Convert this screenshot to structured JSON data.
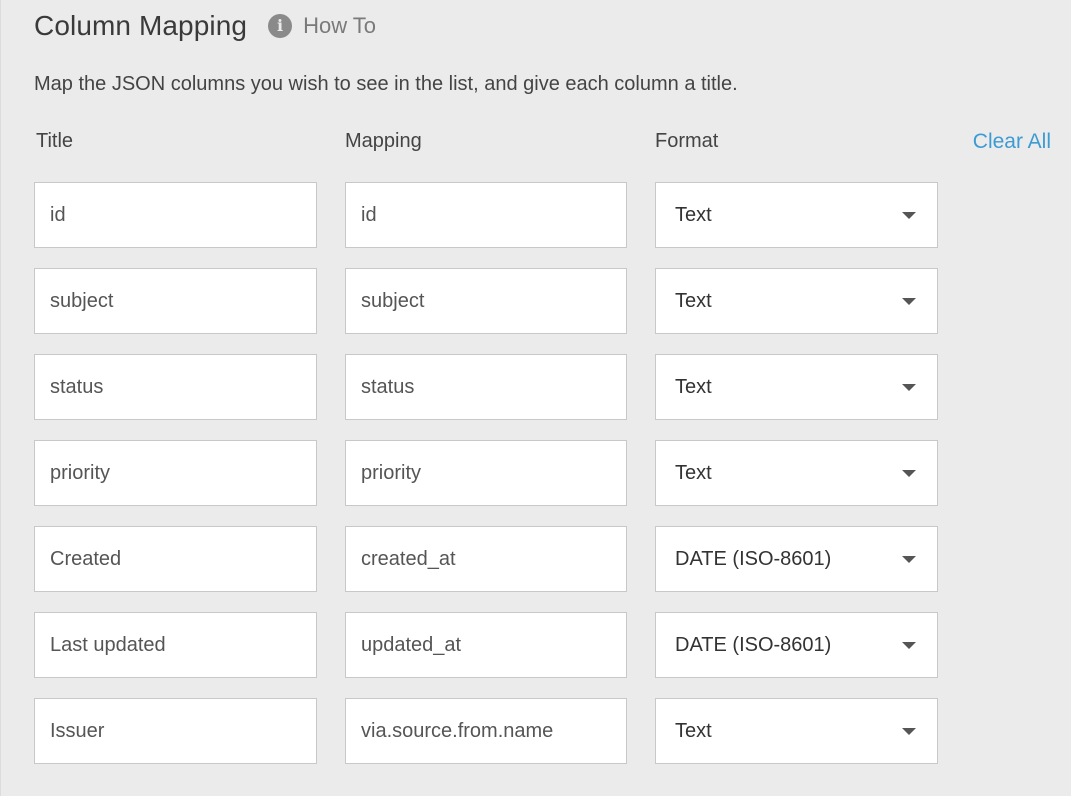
{
  "header": {
    "title": "Column Mapping",
    "info_icon": "info-circle-icon",
    "howto_label": "How To"
  },
  "description": "Map the JSON columns you wish to see in the list, and give each column a title.",
  "columns": {
    "title_label": "Title",
    "mapping_label": "Mapping",
    "format_label": "Format",
    "clear_all_label": "Clear All"
  },
  "rows": [
    {
      "title": "id",
      "mapping": "id",
      "format": "Text"
    },
    {
      "title": "subject",
      "mapping": "subject",
      "format": "Text"
    },
    {
      "title": "status",
      "mapping": "status",
      "format": "Text"
    },
    {
      "title": "priority",
      "mapping": "priority",
      "format": "Text"
    },
    {
      "title": "Created",
      "mapping": "created_at",
      "format": "DATE (ISO-8601)"
    },
    {
      "title": "Last updated",
      "mapping": "updated_at",
      "format": "DATE (ISO-8601)"
    },
    {
      "title": "Issuer",
      "mapping": "via.source.from.name",
      "format": "Text"
    }
  ],
  "colors": {
    "background": "#ebebeb",
    "link": "#3d9bd4",
    "field_border": "#c8c8c8"
  }
}
